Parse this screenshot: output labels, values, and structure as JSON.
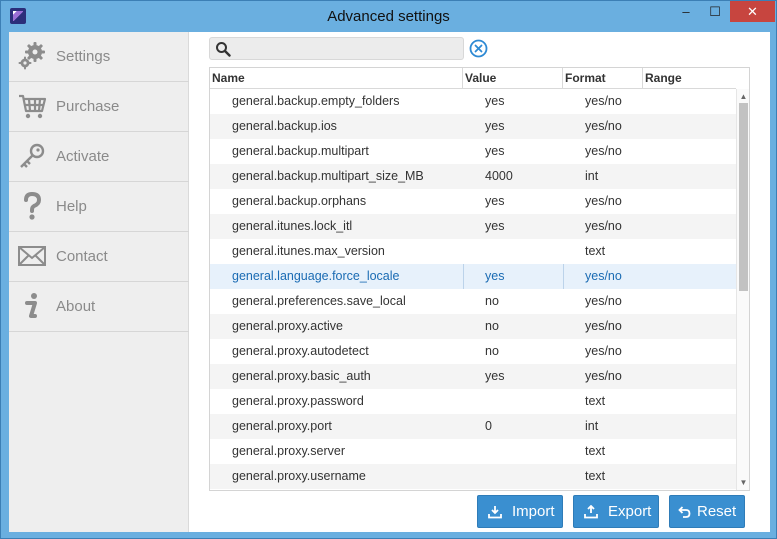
{
  "window": {
    "title": "Advanced settings",
    "controls": {
      "minimize": "–",
      "maximize": "☐",
      "close": "✕"
    }
  },
  "sidebar": {
    "items": [
      {
        "label": "Settings",
        "icon": "gear-icon"
      },
      {
        "label": "Purchase",
        "icon": "cart-icon"
      },
      {
        "label": "Activate",
        "icon": "key-icon"
      },
      {
        "label": "Help",
        "icon": "question-icon"
      },
      {
        "label": "Contact",
        "icon": "envelope-icon"
      },
      {
        "label": "About",
        "icon": "info-icon"
      }
    ]
  },
  "search": {
    "value": "",
    "placeholder": ""
  },
  "table": {
    "columns": {
      "name": "Name",
      "value": "Value",
      "format": "Format",
      "range": "Range"
    },
    "rows": [
      {
        "name": "general.backup.empty_folders",
        "value": "yes",
        "format": "yes/no",
        "range": ""
      },
      {
        "name": "general.backup.ios",
        "value": "yes",
        "format": "yes/no",
        "range": ""
      },
      {
        "name": "general.backup.multipart",
        "value": "yes",
        "format": "yes/no",
        "range": ""
      },
      {
        "name": "general.backup.multipart_size_MB",
        "value": "4000",
        "format": "int",
        "range": ""
      },
      {
        "name": "general.backup.orphans",
        "value": "yes",
        "format": "yes/no",
        "range": ""
      },
      {
        "name": "general.itunes.lock_itl",
        "value": "yes",
        "format": "yes/no",
        "range": ""
      },
      {
        "name": "general.itunes.max_version",
        "value": "",
        "format": "text",
        "range": ""
      },
      {
        "name": "general.language.force_locale",
        "value": "yes",
        "format": "yes/no",
        "range": ""
      },
      {
        "name": "general.preferences.save_local",
        "value": "no",
        "format": "yes/no",
        "range": ""
      },
      {
        "name": "general.proxy.active",
        "value": "no",
        "format": "yes/no",
        "range": ""
      },
      {
        "name": "general.proxy.autodetect",
        "value": "no",
        "format": "yes/no",
        "range": ""
      },
      {
        "name": "general.proxy.basic_auth",
        "value": "yes",
        "format": "yes/no",
        "range": ""
      },
      {
        "name": "general.proxy.password",
        "value": "",
        "format": "text",
        "range": ""
      },
      {
        "name": "general.proxy.port",
        "value": "0",
        "format": "int",
        "range": ""
      },
      {
        "name": "general.proxy.server",
        "value": "",
        "format": "text",
        "range": ""
      },
      {
        "name": "general.proxy.username",
        "value": "",
        "format": "text",
        "range": ""
      }
    ],
    "selected_index": 7
  },
  "buttons": {
    "import": "Import",
    "export": "Export",
    "reset": "Reset"
  },
  "colors": {
    "titlebar": "#6aafe0",
    "close_button": "#c7453f",
    "button_primary": "#3a8fd0",
    "selection_text": "#1a6bb3",
    "clear_icon": "#2e8ad4"
  }
}
